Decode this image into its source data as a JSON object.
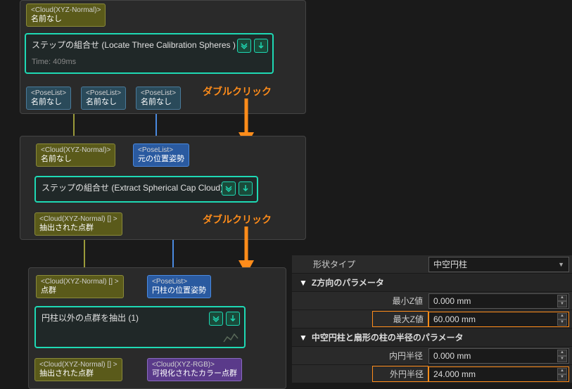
{
  "frame1": {
    "port_in": {
      "type": "<Cloud(XYZ-Normal)>",
      "label": "名前なし"
    },
    "step": {
      "title": "ステップの組合せ (Locate Three Calibration Spheres )",
      "time": "Time: 409ms"
    },
    "ports_out": [
      {
        "type": "<PoseList>",
        "label": "名前なし"
      },
      {
        "type": "<PoseList>",
        "label": "名前なし"
      },
      {
        "type": "<PoseList>",
        "label": "名前なし"
      }
    ]
  },
  "frame2": {
    "port_in_a": {
      "type": "<Cloud(XYZ-Normal)>",
      "label": "名前なし"
    },
    "port_in_b": {
      "type": "<PoseList>",
      "label": "元の位置姿勢"
    },
    "step": {
      "title": "ステップの組合せ (Extract Spherical Cap Cloud)"
    },
    "port_out": {
      "type": "<Cloud(XYZ-Normal) [] >",
      "label": "抽出された点群"
    }
  },
  "frame3": {
    "port_in_a": {
      "type": "<Cloud(XYZ-Normal) [] >",
      "label": "点群"
    },
    "port_in_b": {
      "type": "<PoseList>",
      "label": "円柱の位置姿勢"
    },
    "step": {
      "title": "円柱以外の点群を抽出 (1)"
    },
    "port_out_a": {
      "type": "<Cloud(XYZ-Normal) [] >",
      "label": "抽出された点群"
    },
    "port_out_b": {
      "type": "<Cloud(XYZ-RGB)>",
      "label": "可視化されたカラー点群"
    }
  },
  "labels": {
    "dblclick": "ダブルクリック"
  },
  "props": {
    "shape_type_label": "形状タイプ",
    "shape_type_value": "中空円柱",
    "z_header": "Z方向のパラメータ",
    "min_z_label": "最小Z値",
    "min_z_value": "0.000 mm",
    "max_z_label": "最大Z値",
    "max_z_value": "60.000 mm",
    "radius_header": "中空円柱と扇形の柱の半径のパラメータ",
    "inner_r_label": "内円半径",
    "inner_r_value": "0.000 mm",
    "outer_r_label": "外円半径",
    "outer_r_value": "24.000 mm"
  }
}
